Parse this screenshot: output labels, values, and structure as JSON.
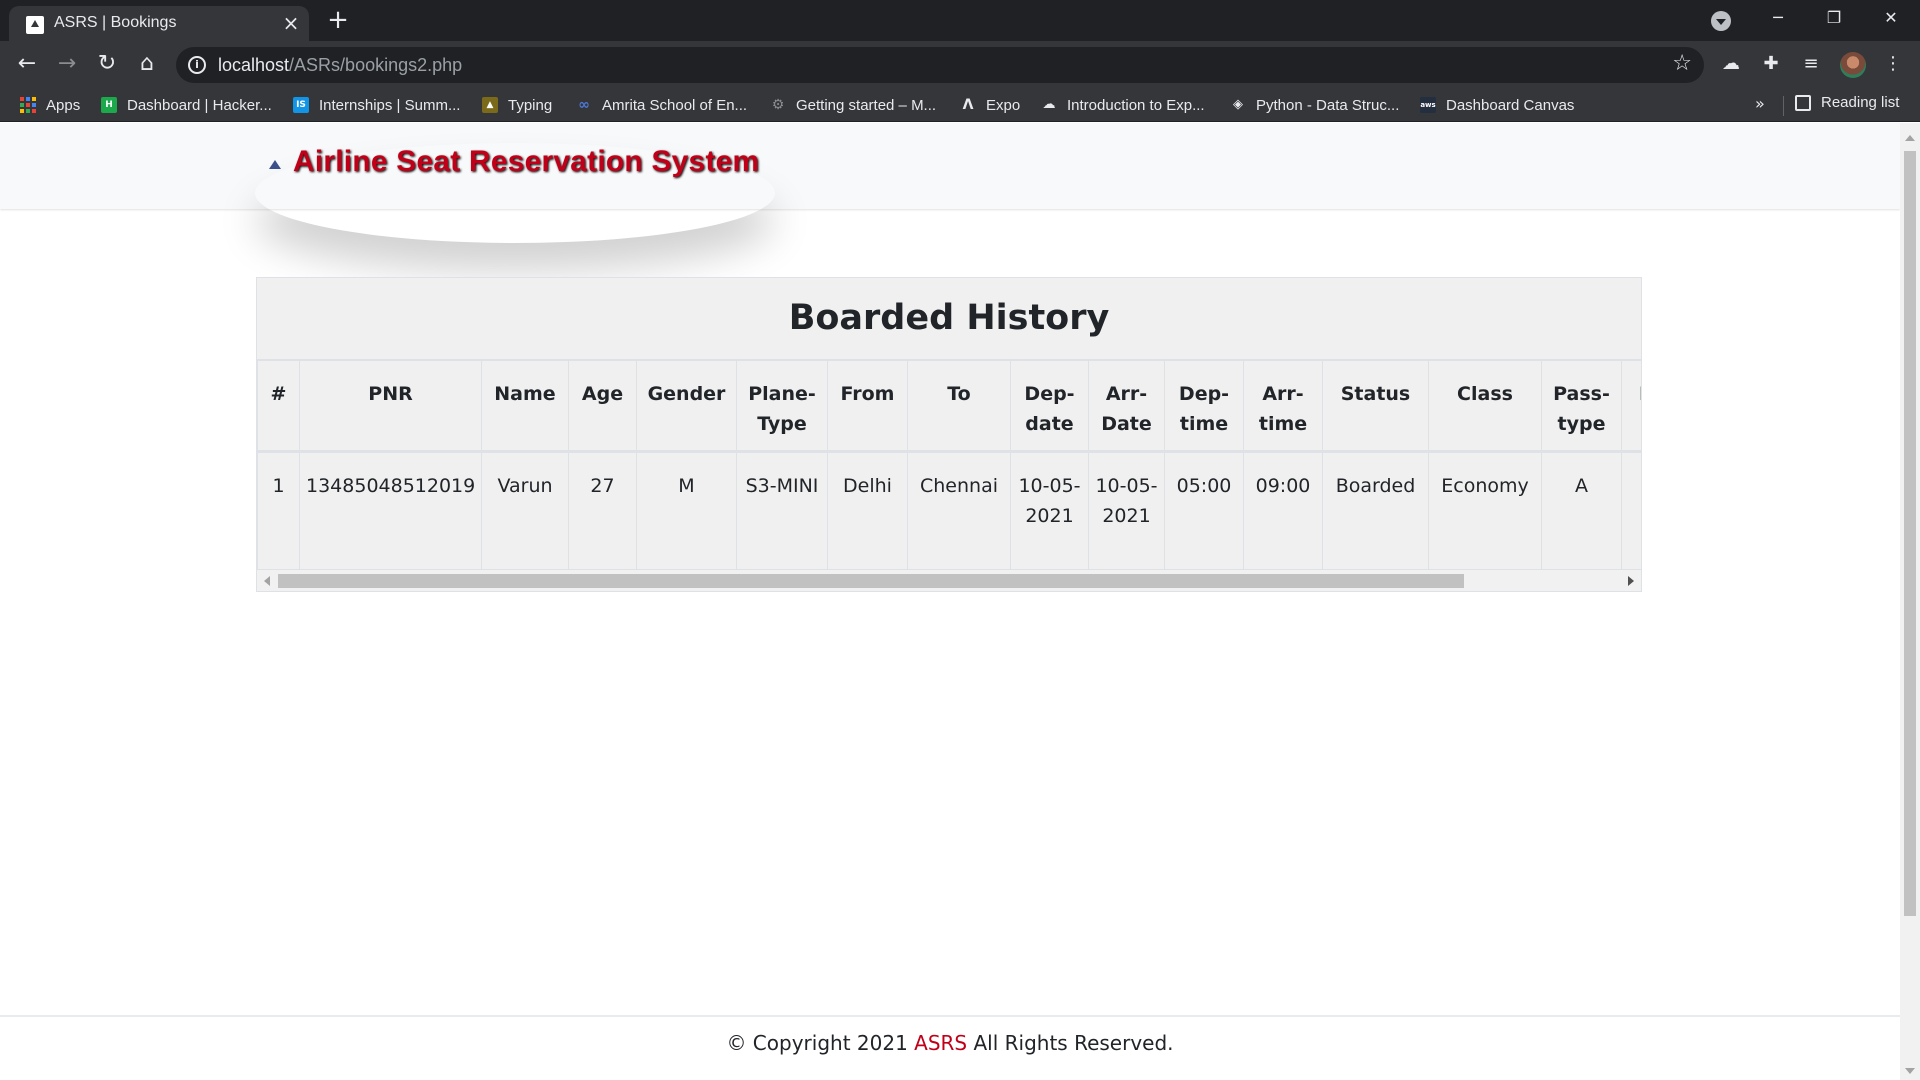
{
  "browser": {
    "tab_title": "ASRS | Bookings",
    "url_host": "localhost",
    "url_path": "/ASRs/bookings2.php",
    "bookmarks": [
      {
        "label": "Apps",
        "icon": "apps-grid-icon"
      },
      {
        "label": "Dashboard | Hacker...",
        "icon": "hackerrank-icon",
        "color": "#1ba94c"
      },
      {
        "label": "Internships | Summ...",
        "icon": "internshala-icon",
        "color": "#1295e6"
      },
      {
        "label": "Typing",
        "icon": "typing-icon",
        "color": "#7a6a1a"
      },
      {
        "label": "Amrita School of En...",
        "icon": "infinity-icon",
        "color": "#4d7ad8"
      },
      {
        "label": "Getting started – M...",
        "icon": "gear-icon",
        "color": "#8a8c90"
      },
      {
        "label": "Expo",
        "icon": "expo-icon",
        "color": "#1c2a4f"
      },
      {
        "label": "Introduction to Exp...",
        "icon": "cloud-icon",
        "color": "#8a8c90"
      },
      {
        "label": "Python - Data Struc...",
        "icon": "diamond-icon",
        "color": "#8a8c90"
      },
      {
        "label": "Dashboard Canvas",
        "icon": "aws-icon",
        "color": "#232f3e"
      }
    ],
    "reading_list_label": "Reading list",
    "more_bookmarks": "»"
  },
  "page": {
    "brand": "Airline Seat Reservation System",
    "card_title": "Boarded History",
    "table": {
      "headers": [
        "#",
        "PNR",
        "Name",
        "Age",
        "Gender",
        "Plane-Type",
        "From",
        "To",
        "Dep-date",
        "Arr-Date",
        "Dep-time",
        "Arr-time",
        "Status",
        "Class",
        "Pass-type",
        "I"
      ],
      "rows": [
        [
          "1",
          "13485048512019",
          "Varun",
          "27",
          "M",
          "S3-MINI",
          "Delhi",
          "Chennai",
          "10-05-2021",
          "10-05-2021",
          "05:00",
          "09:00",
          "Boarded",
          "Economy",
          "A",
          ""
        ]
      ]
    },
    "footer": {
      "prefix": "© Copyright 2021",
      "brand": "ASRS",
      "suffix": "All Rights Reserved."
    }
  },
  "colors": {
    "brand_red": "#c00018",
    "chrome_dark": "#202124",
    "chrome_toolbar": "#35363a"
  }
}
